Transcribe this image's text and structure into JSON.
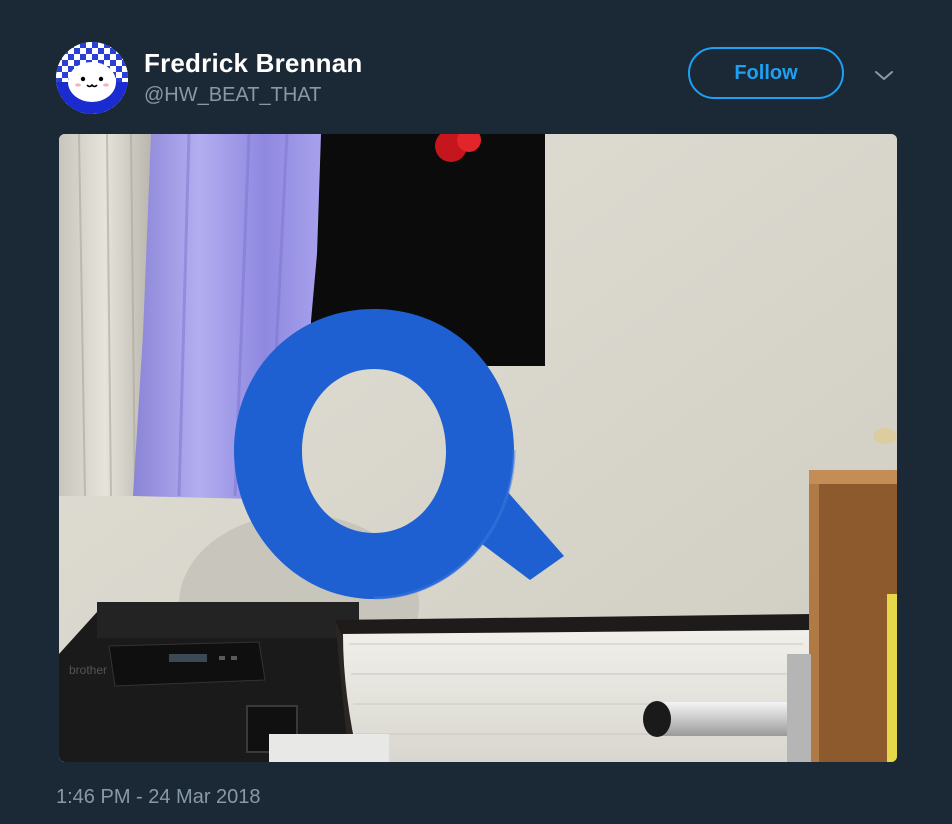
{
  "user": {
    "name": "Fredrick Brennan",
    "handle": "@HW_BEAT_THAT"
  },
  "actions": {
    "follow_label": "Follow"
  },
  "photo": {
    "subject_letter": "Q",
    "printer_brand": "brother"
  },
  "tweet": {
    "timestamp": "1:46 PM - 24 Mar 2018"
  },
  "colors": {
    "background": "#1b2836",
    "accent": "#1da1f2",
    "muted_text": "#8899a6",
    "letter_blue": "#1e5fd1"
  },
  "icons": {
    "menu": "chevron-down-icon"
  }
}
